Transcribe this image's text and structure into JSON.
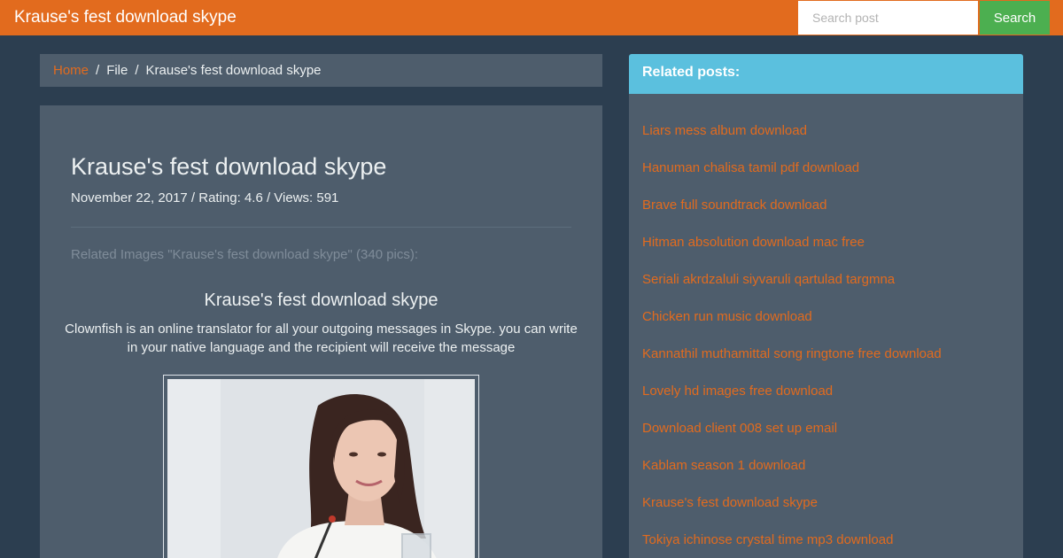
{
  "header": {
    "brand": "Krause's fest download skype",
    "search_placeholder": "Search post",
    "search_label": "Search"
  },
  "breadcrumb": {
    "home": "Home",
    "file": "File",
    "current": "Krause's fest download skype"
  },
  "post": {
    "title": "Krause's fest download skype",
    "meta": "November 22, 2017 / Rating: 4.6 / Views: 591",
    "related_images": "Related Images \"Krause's fest download skype\" (340 pics):",
    "image_title": "Krause's fest download skype",
    "image_caption": "Clownfish is an online translator for all your outgoing messages in Skype. you can write in your native language and the recipient will receive the message"
  },
  "sidebar": {
    "title": "Related posts:",
    "items": [
      "Liars mess album download",
      "Hanuman chalisa tamil pdf download",
      "Brave full soundtrack download",
      "Hitman absolution download mac free",
      "Seriali akrdzaluli siyvaruli qartulad targmna",
      "Chicken run music download",
      "Kannathil muthamittal song ringtone free download",
      "Lovely hd images free download",
      "Download client 008 set up email",
      "Kablam season 1 download",
      "Krause's fest download skype",
      "Tokiya ichinose crystal time mp3 download"
    ]
  },
  "colors": {
    "background": "#2c3e50",
    "navbar": "#e26b1e",
    "panel": "#4e5d6c",
    "sidebar_header": "#5bc0de",
    "search_button": "#4caf50",
    "link": "#e26b1e"
  }
}
